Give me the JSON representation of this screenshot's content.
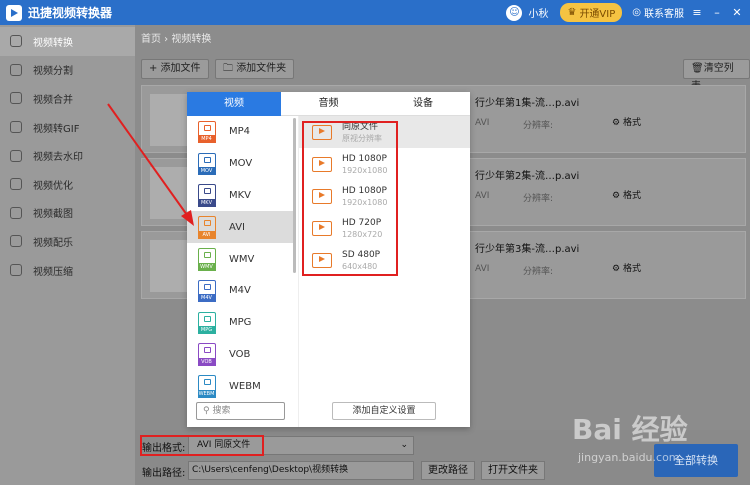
{
  "app": {
    "title": "迅捷视频转换器",
    "user": "小秋",
    "vip": "开通VIP",
    "kefu": "联系客服"
  },
  "sidebar": {
    "items": [
      {
        "label": "视频转换",
        "active": true
      },
      {
        "label": "视频分割"
      },
      {
        "label": "视频合并"
      },
      {
        "label": "视频转GIF"
      },
      {
        "label": "视频去水印"
      },
      {
        "label": "视频优化"
      },
      {
        "label": "视频截图"
      },
      {
        "label": "视频配乐"
      },
      {
        "label": "视频压缩"
      }
    ]
  },
  "breadcrumb": "首页 › 视频转换",
  "toolbar": {
    "add_file": "+ 添加文件",
    "add_folder": "添加文件夹",
    "clear": "清空列表"
  },
  "files": [
    {
      "name": "行少年第1集-流…p.avi",
      "meta1": "AVI",
      "meta2": "分辨率:",
      "settings": "格式"
    },
    {
      "name": "行少年第2集-流…p.avi",
      "meta1": "AVI",
      "meta2": "分辨率:",
      "settings": "格式"
    },
    {
      "name": "行少年第3集-流…p.avi",
      "meta1": "AVI",
      "meta2": "分辨率:",
      "settings": "格式"
    }
  ],
  "popup": {
    "tabs": [
      "视频",
      "音频",
      "设备"
    ],
    "formats": [
      {
        "label": "MP4",
        "tag": "MP4",
        "color": "#e8612c"
      },
      {
        "label": "MOV",
        "tag": "MOV",
        "color": "#2b6cb8"
      },
      {
        "label": "MKV",
        "tag": "MKV",
        "color": "#3a4a8a"
      },
      {
        "label": "AVI",
        "tag": "AVI",
        "color": "#e8842c"
      },
      {
        "label": "WMV",
        "tag": "WMV",
        "color": "#6ab04c"
      },
      {
        "label": "M4V",
        "tag": "M4V",
        "color": "#3c6cc4"
      },
      {
        "label": "MPG",
        "tag": "MPG",
        "color": "#2cb0a0"
      },
      {
        "label": "VOB",
        "tag": "VOB",
        "color": "#8a4ac4"
      },
      {
        "label": "WEBM",
        "tag": "WEBM",
        "color": "#2c8ac4"
      }
    ],
    "search_placeholder": "搜索",
    "qualities": [
      {
        "name": "同原文件",
        "res": "原视分辨率"
      },
      {
        "name": "HD 1080P",
        "res": "1920x1080"
      },
      {
        "name": "HD 1080P",
        "res": "1920x1080"
      },
      {
        "name": "HD 720P",
        "res": "1280x720"
      },
      {
        "name": "SD 480P",
        "res": "640x480"
      }
    ],
    "custom": "添加自定义设置"
  },
  "bottom": {
    "format_label": "输出格式:",
    "format_value": "AVI  同原文件",
    "path_label": "输出路径:",
    "path_value": "C:\\Users\\cenfeng\\Desktop\\视频转换",
    "change_path": "更改路径",
    "open_folder": "打开文件夹",
    "convert_all": "全部转换"
  },
  "watermark": {
    "main": "Bai 经验",
    "sub": "jingyan.baidu.com"
  },
  "colors": {
    "accent": "#2a7ae2",
    "highlight": "#e02020"
  }
}
